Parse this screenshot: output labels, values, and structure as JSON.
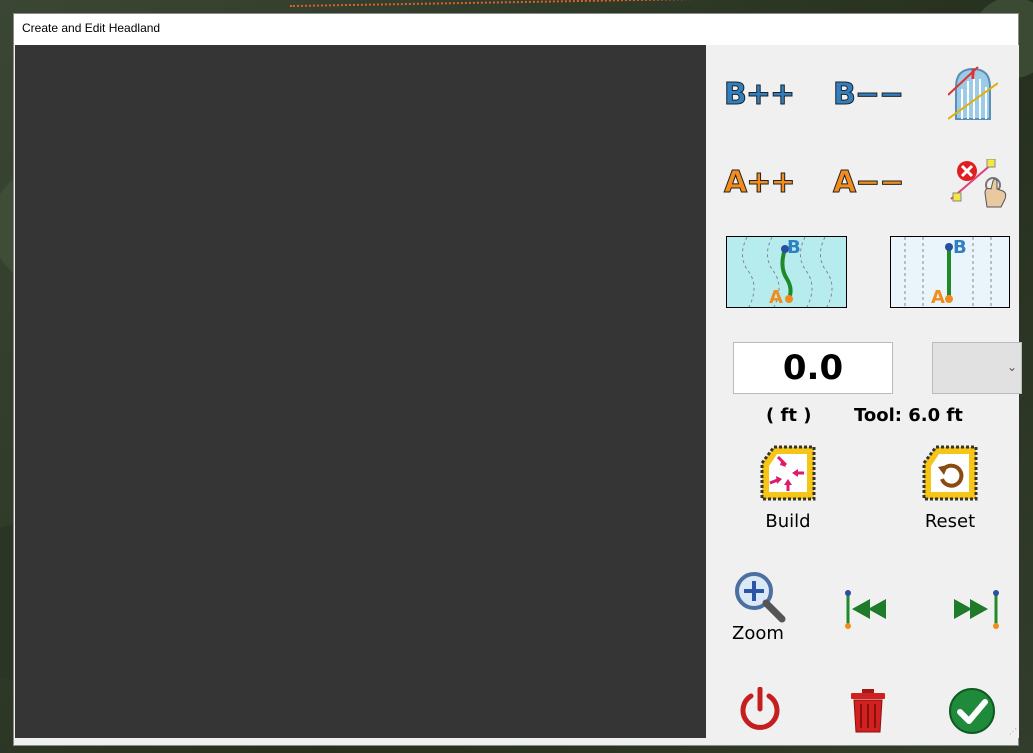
{
  "window": {
    "title": "Create and Edit Headland"
  },
  "buttons": {
    "b_plus": "B++",
    "b_minus": "B−−",
    "a_plus": "A++",
    "a_minus": "A−−",
    "build_label": "Build",
    "reset_label": "Reset",
    "zoom_label": "Zoom"
  },
  "curve_thumb": {
    "a": "A",
    "b": "B"
  },
  "line_thumb": {
    "a": "A",
    "b": "B"
  },
  "distance": {
    "value": "0.0",
    "unit_label": "( ft )",
    "tool_label": "Tool: 6.0 ft"
  },
  "colors": {
    "b_blue": "#2f7fc1",
    "a_orange": "#f28c1c",
    "canvas": "#353535"
  },
  "icons": {
    "headland_icon": "headland-hatch-icon",
    "delete_points": "delete-points-icon",
    "build": "build-headland-icon",
    "reset": "reset-headland-icon",
    "zoom": "zoom-in-icon",
    "move_start": "move-to-start-icon",
    "move_end": "move-to-end-icon",
    "power": "power-icon",
    "trash": "trash-icon",
    "ok": "ok-check-icon"
  }
}
